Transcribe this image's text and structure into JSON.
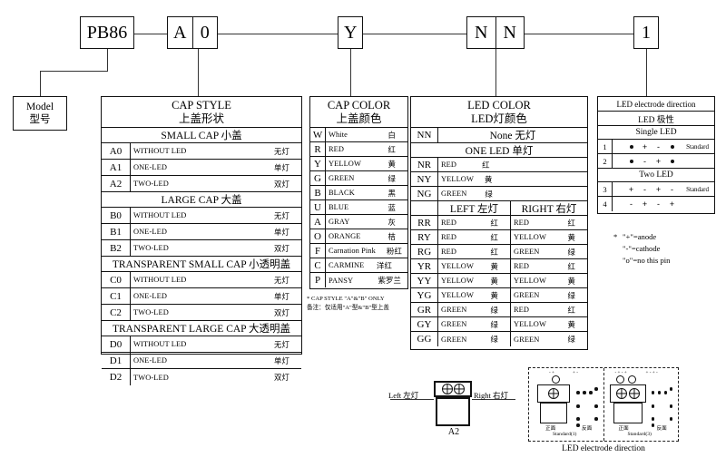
{
  "code_boxes": [
    {
      "name": "model-code",
      "cells": [
        "PB86"
      ]
    },
    {
      "name": "cap-style-code",
      "cells": [
        "A",
        "0"
      ]
    },
    {
      "name": "cap-color-code",
      "cells": [
        "Y"
      ]
    },
    {
      "name": "led-color-code",
      "cells": [
        "N",
        "N"
      ]
    },
    {
      "name": "electrode-code",
      "cells": [
        "1"
      ]
    }
  ],
  "model_box": {
    "en": "Model",
    "cn": "型号"
  },
  "cap_style": {
    "title_en": "CAP STYLE",
    "title_cn": "上盖形状",
    "groups": [
      {
        "header": "SMALL CAP 小盖",
        "rows": [
          {
            "code": "A0",
            "en": "WITHOUT LED",
            "cn": "无灯"
          },
          {
            "code": "A1",
            "en": "ONE-LED",
            "cn": "单灯"
          },
          {
            "code": "A2",
            "en": "TWO-LED",
            "cn": "双灯"
          }
        ]
      },
      {
        "header": "LARGE CAP 大盖",
        "rows": [
          {
            "code": "B0",
            "en": "WITHOUT LED",
            "cn": "无灯"
          },
          {
            "code": "B1",
            "en": "ONE-LED",
            "cn": "单灯"
          },
          {
            "code": "B2",
            "en": "TWO-LED",
            "cn": "双灯"
          }
        ]
      },
      {
        "header": "TRANSPARENT SMALL CAP 小透明盖",
        "rows": [
          {
            "code": "C0",
            "en": "WITHOUT LED",
            "cn": "无灯"
          },
          {
            "code": "C1",
            "en": "ONE-LED",
            "cn": "单灯"
          },
          {
            "code": "C2",
            "en": "TWO-LED",
            "cn": "双灯"
          }
        ]
      },
      {
        "header": "TRANSPARENT LARGE CAP 大透明盖",
        "rows": [
          {
            "code": "D0",
            "en": "WITHOUT LED",
            "cn": "无灯"
          },
          {
            "code": "D1",
            "en": "ONE-LED",
            "cn": "单灯"
          },
          {
            "code": "D2",
            "en": "TWO-LED",
            "cn": "双灯"
          }
        ]
      }
    ]
  },
  "cap_color": {
    "title_en": "CAP COLOR",
    "title_cn": "上盖颜色",
    "rows": [
      {
        "code": "W",
        "en": "White",
        "cn": "白"
      },
      {
        "code": "R",
        "en": "RED",
        "cn": "红"
      },
      {
        "code": "Y",
        "en": "YELLOW",
        "cn": "黄"
      },
      {
        "code": "G",
        "en": "GREEN",
        "cn": "绿"
      },
      {
        "code": "B",
        "en": "BLACK",
        "cn": "黑"
      },
      {
        "code": "U",
        "en": "BLUE",
        "cn": "蓝"
      },
      {
        "code": "A",
        "en": "GRAY",
        "cn": "灰"
      },
      {
        "code": "O",
        "en": "ORANGE",
        "cn": "桔"
      },
      {
        "code": "F",
        "en": "Carnation Pink",
        "cn": "粉红"
      },
      {
        "code": "C",
        "en": "CARMINE",
        "cn": "洋红"
      },
      {
        "code": "P",
        "en": "PANSY",
        "cn": "紫罗兰"
      }
    ],
    "footnote_en": "* CAP STYLE \"A\"&\"B\" ONLY",
    "footnote_cn": "备注：仅适用\"A\"型&\"B\"型上盖"
  },
  "led_color": {
    "title_en": "LED COLOR",
    "title_cn": "LED灯颜色",
    "none_row": {
      "code": "NN",
      "label": "None 无灯"
    },
    "one_led_header": "ONE LED 单灯",
    "one_led_rows": [
      {
        "code": "NR",
        "en": "RED",
        "cn": "红"
      },
      {
        "code": "NY",
        "en": "YELLOW",
        "cn": "黄"
      },
      {
        "code": "NG",
        "en": "GREEN",
        "cn": "绿"
      }
    ],
    "two_led_col_left": "LEFT 左灯",
    "two_led_col_right": "RIGHT 右灯",
    "two_led_rows": [
      {
        "code": "RR",
        "left_en": "RED",
        "left_cn": "红",
        "right_en": "RED",
        "right_cn": "红"
      },
      {
        "code": "RY",
        "left_en": "RED",
        "left_cn": "红",
        "right_en": "YELLOW",
        "right_cn": "黄"
      },
      {
        "code": "RG",
        "left_en": "RED",
        "left_cn": "红",
        "right_en": "GREEN",
        "right_cn": "绿"
      },
      {
        "code": "YR",
        "left_en": "YELLOW",
        "left_cn": "黄",
        "right_en": "RED",
        "right_cn": "红"
      },
      {
        "code": "YY",
        "left_en": "YELLOW",
        "left_cn": "黄",
        "right_en": "YELLOW",
        "right_cn": "黄"
      },
      {
        "code": "YG",
        "left_en": "YELLOW",
        "left_cn": "黄",
        "right_en": "GREEN",
        "right_cn": "绿"
      },
      {
        "code": "GR",
        "left_en": "GREEN",
        "left_cn": "绿",
        "right_en": "RED",
        "right_cn": "红"
      },
      {
        "code": "GY",
        "left_en": "GREEN",
        "left_cn": "绿",
        "right_en": "YELLOW",
        "right_cn": "黄"
      },
      {
        "code": "GG",
        "left_en": "GREEN",
        "left_cn": "绿",
        "right_en": "GREEN",
        "right_cn": "绿"
      }
    ]
  },
  "electrode": {
    "title_en": "LED electrode direction",
    "title_cn": "LED 极性",
    "single_header": "Single LED",
    "two_header": "Two LED",
    "standard_label": "Standard",
    "single_rows": [
      {
        "code": "1",
        "symbols": [
          "o",
          "+",
          "-",
          "o"
        ],
        "note": "Standard"
      },
      {
        "code": "2",
        "symbols": [
          "o",
          "-",
          "+",
          "o"
        ],
        "note": ""
      }
    ],
    "two_rows": [
      {
        "code": "3",
        "symbols": [
          "+",
          "-",
          "+",
          "-"
        ],
        "note": "Standard"
      },
      {
        "code": "4",
        "symbols": [
          "-",
          "+",
          "-",
          "+"
        ],
        "note": ""
      }
    ],
    "legend": [
      "\"+\"=anode",
      "\"-\"=cathode",
      "\"o\"=no this pin"
    ]
  },
  "a2_drawing": {
    "left_label": "Left 左灯",
    "right_label": "Right 右灯",
    "name": "A2"
  },
  "bottom_diagram": {
    "caption": "LED electrode direction",
    "panels": [
      {
        "std": "Standard(1)",
        "front": "正面",
        "back": "反面",
        "top_marks": [
          "- +",
          "+  -"
        ]
      },
      {
        "std": "Standard(3)",
        "front": "正面",
        "back": "反面",
        "top_marks": [
          "- + - +",
          "+ - + -"
        ]
      }
    ]
  }
}
